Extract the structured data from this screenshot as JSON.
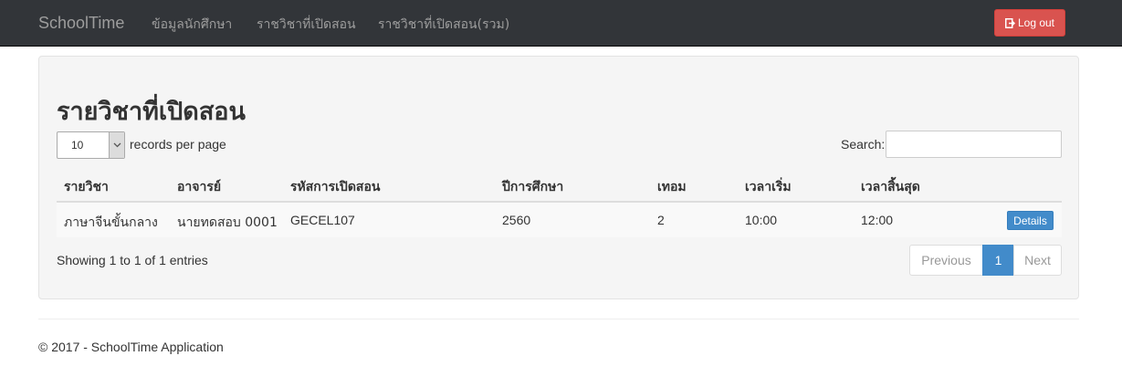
{
  "navbar": {
    "brand": "SchoolTime",
    "links": [
      "ข้อมูลนักศึกษา",
      "ราชวิชาที่เปิดสอน",
      "ราชวิชาที่เปิดสอน(รวม)"
    ],
    "logout_label": "Log out"
  },
  "page": {
    "title": "รายวิชาที่เปิดสอน"
  },
  "table_controls": {
    "page_length": "10",
    "length_label": "records per page",
    "search_label": "Search:",
    "search_value": ""
  },
  "table": {
    "columns": [
      "รายวิชา",
      "อาจารย์",
      "รหัสการเปิดสอน",
      "ปีการศึกษา",
      "เทอม",
      "เวลาเริ่ม",
      "เวลาสิ้นสุด"
    ],
    "rows": [
      {
        "cells": [
          "ภาษาจีนขั้นกลาง",
          "นายทดสอบ 0001",
          "GECEL107",
          "2560",
          "2",
          "10:00",
          "12:00"
        ],
        "action_label": "Details"
      }
    ],
    "info": "Showing 1 to 1 of 1 entries"
  },
  "pagination": {
    "previous": "Previous",
    "current": "1",
    "next": "Next"
  },
  "footer": {
    "text": "© 2017 - SchoolTime Application"
  },
  "colors": {
    "navbar_bg": "#323539",
    "danger": "#d9534f",
    "primary": "#428bca"
  }
}
